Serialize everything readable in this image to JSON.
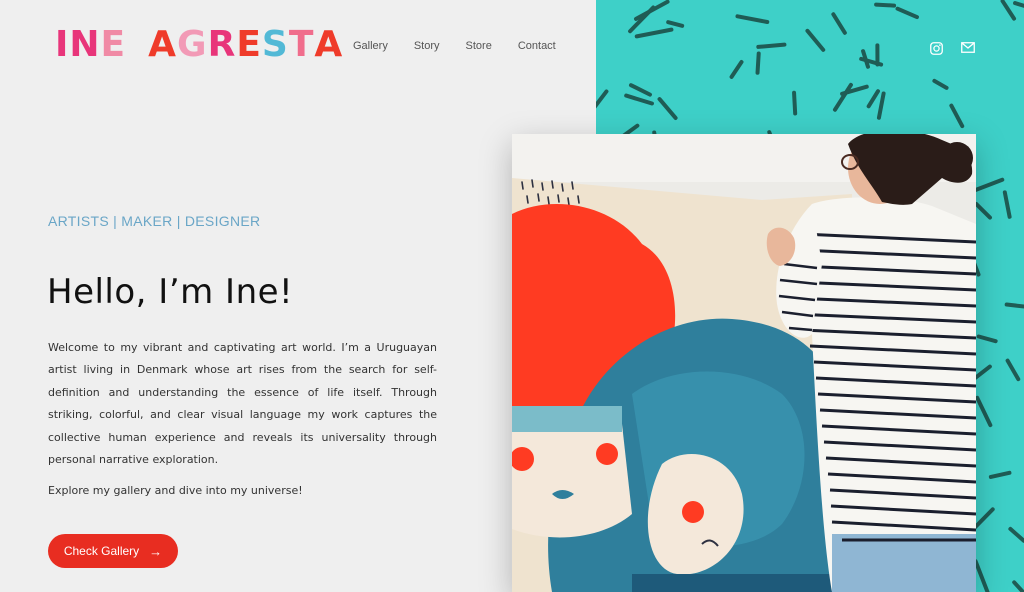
{
  "brand": {
    "logo_text": "INE AGRESTA",
    "logo_letters": [
      {
        "ch": "I",
        "color": "#e8357a"
      },
      {
        "ch": "N",
        "color": "#e8357a"
      },
      {
        "ch": "E",
        "color": "#f08aa5"
      },
      {
        "ch": "A",
        "color": "#ef3b2a"
      },
      {
        "ch": "G",
        "color": "#f29ab6"
      },
      {
        "ch": "R",
        "color": "#e8357a"
      },
      {
        "ch": "E",
        "color": "#ef3b2a"
      },
      {
        "ch": "S",
        "color": "#52b9d6"
      },
      {
        "ch": "T",
        "color": "#f06d8c"
      },
      {
        "ch": "A",
        "color": "#ef3b2a"
      }
    ]
  },
  "nav": {
    "items": [
      "Gallery",
      "Story",
      "Store",
      "Contact"
    ]
  },
  "social": {
    "icons": [
      "instagram-icon",
      "mail-icon"
    ]
  },
  "hero": {
    "subheading": "ARTISTS | MAKER | DESIGNER",
    "title": "Hello, I’m Ine!",
    "intro": "Welcome to my vibrant and captivating art world. I’m a Uruguayan artist living in Denmark whose art rises from the search for self-definition and understanding the essence of life itself. Through striking, colorful, and clear visual language my work captures the collective human experience and reveals its universality through personal narrative exploration.",
    "explore": "Explore my gallery and dive into my universe!",
    "cta_label": "Check Gallery",
    "cta_arrow": "→"
  },
  "colors": {
    "accent_red": "#e82d21",
    "subhead_blue": "#6aa6c7",
    "teal": "#3ed0c8",
    "background": "#efefef"
  }
}
